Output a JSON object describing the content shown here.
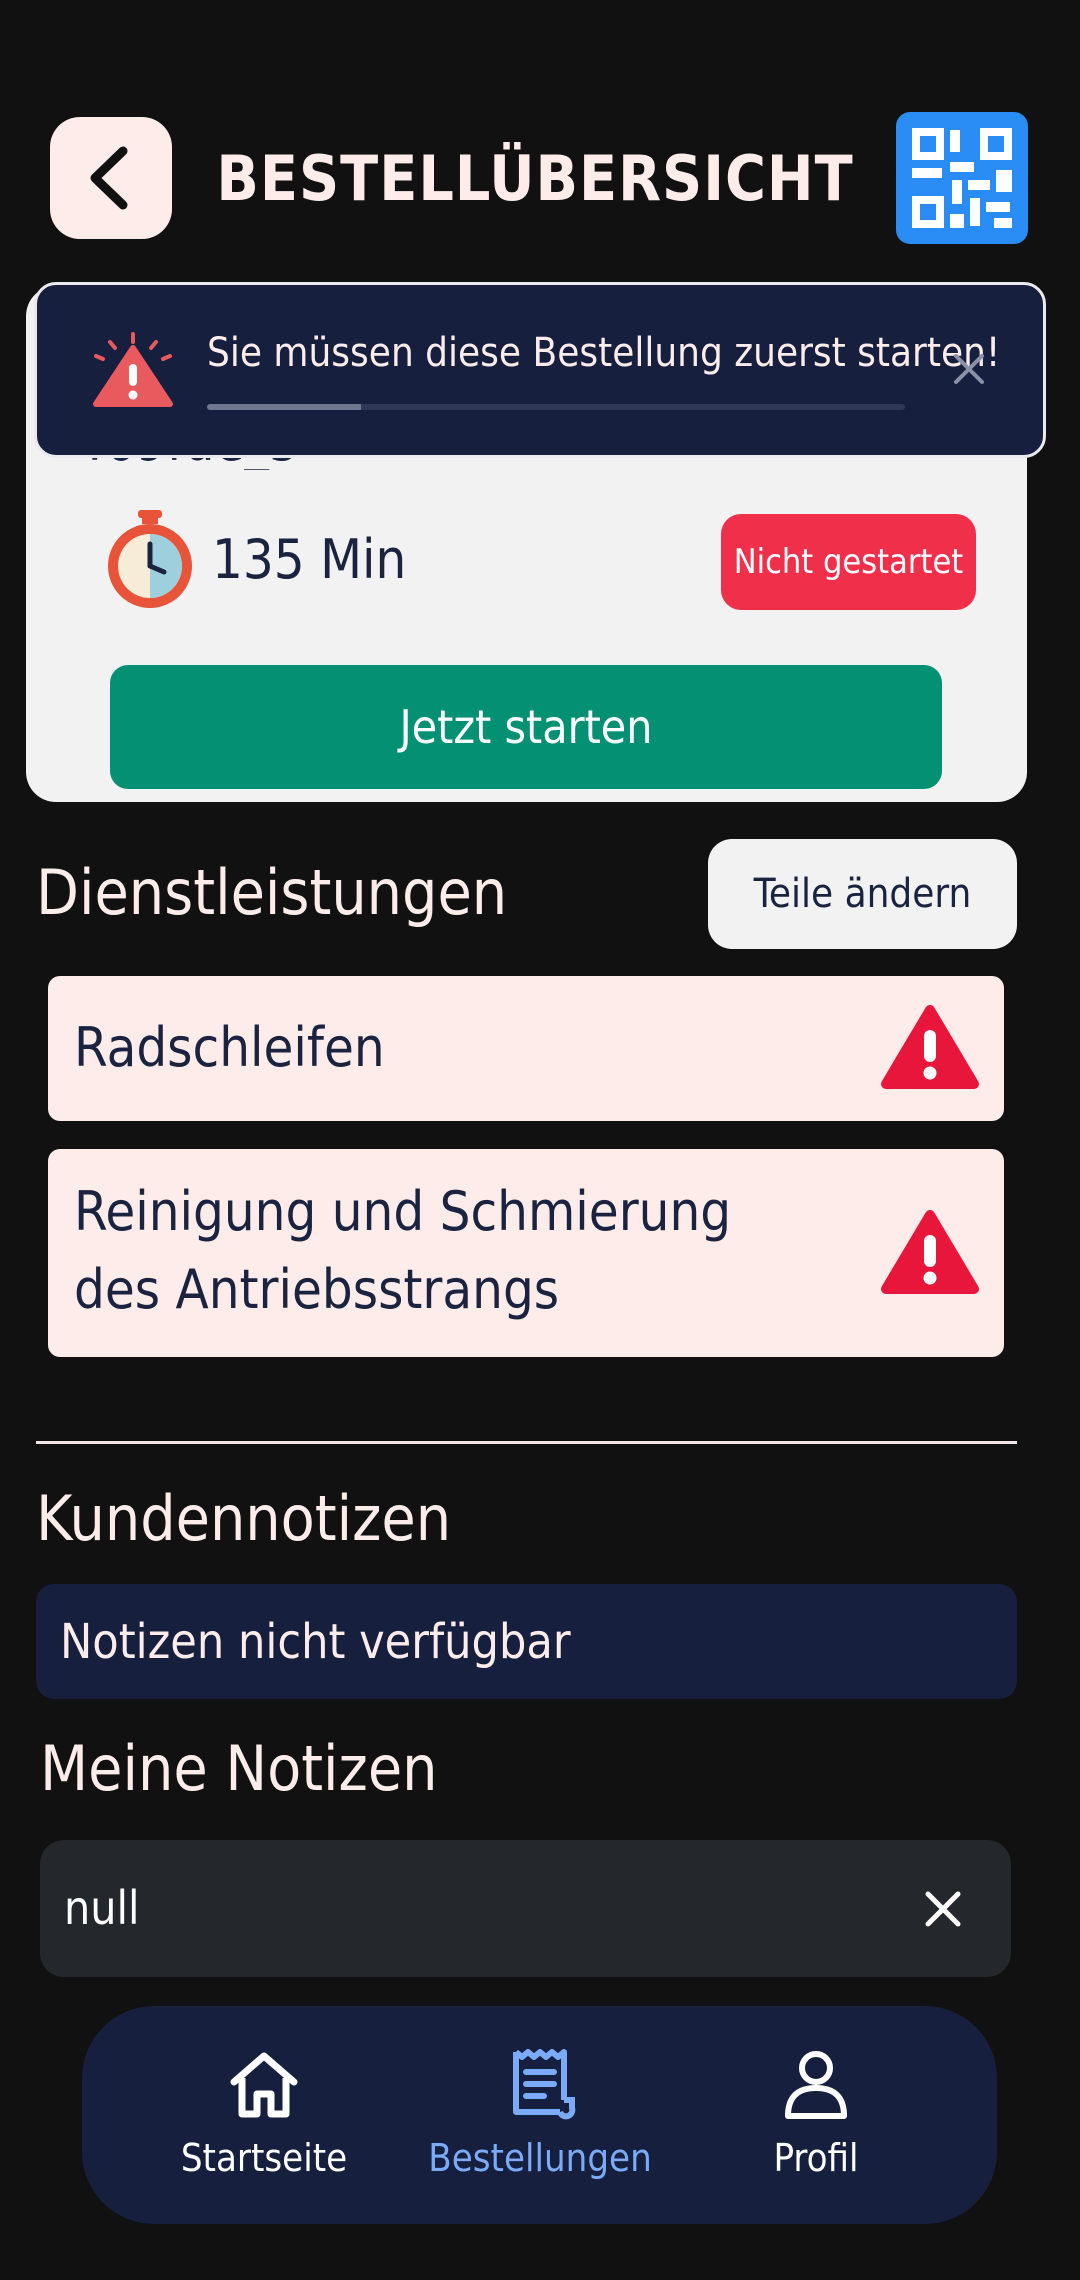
{
  "header": {
    "title": "BESTELLÜBERSICHT",
    "back_icon": "chevron-left-icon",
    "qr_icon": "qr-code-icon"
  },
  "toast": {
    "message": "Sie müssen diese Bestellung zuerst starten!",
    "icon": "alarm-warning-icon",
    "progress_fraction": 0.22
  },
  "order": {
    "id_partial": "469fde_5",
    "duration": "135 Min",
    "status": "Nicht gestartet",
    "start_label": "Jetzt starten"
  },
  "services": {
    "title": "Dienstleistungen",
    "edit_label": "Teile ändern",
    "items": [
      {
        "line1": "Radschleifen",
        "line2": ""
      },
      {
        "line1": "Reinigung und Schmierung",
        "line2": "des Antriebsstrangs"
      }
    ]
  },
  "customer_notes": {
    "title": "Kundennotizen",
    "text": "Notizen nicht verfügbar"
  },
  "my_notes": {
    "title": "Meine Notizen",
    "value": "null"
  },
  "nav": {
    "items": [
      {
        "label": "Startseite",
        "icon": "home-icon",
        "active": false
      },
      {
        "label": "Bestellungen",
        "icon": "receipt-icon",
        "active": true
      },
      {
        "label": "Profil",
        "icon": "user-icon",
        "active": false
      }
    ]
  },
  "colors": {
    "background": "#111111",
    "accent_green": "#049073",
    "status_red": "#f0304b",
    "nav_active": "#7aaaf8",
    "navy": "#161f3d"
  }
}
